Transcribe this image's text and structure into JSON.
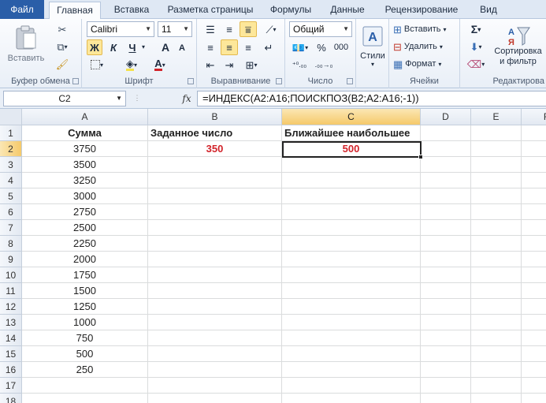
{
  "tabs": [
    "Файл",
    "Главная",
    "Вставка",
    "Разметка страницы",
    "Формулы",
    "Данные",
    "Рецензирование",
    "Вид"
  ],
  "ribbon": {
    "clipboard": {
      "paste_label": "Вставить",
      "group_label": "Буфер обмена"
    },
    "font": {
      "font_name": "Calibri",
      "font_size": "11",
      "bold": "Ж",
      "italic": "К",
      "underline": "Ч",
      "grow": "A",
      "shrink": "A",
      "font_color_glyph": "A",
      "group_label": "Шрифт"
    },
    "alignment": {
      "group_label": "Выравнивание"
    },
    "number": {
      "format": "Общий",
      "percent": "%",
      "thousands": "000",
      "group_label": "Число"
    },
    "styles": {
      "label": "Стили"
    },
    "cells": {
      "insert": "Вставить",
      "delete": "Удалить",
      "format": "Формат",
      "group_label": "Ячейки"
    },
    "editing": {
      "sigma": "Σ",
      "sort_line1": "Сортировка",
      "sort_line2": "и фильтр",
      "group_label": "Редактирова"
    }
  },
  "formula_bar": {
    "name_box": "C2",
    "fx": "fx",
    "formula": "=ИНДЕКС(A2:A16;ПОИСКПОЗ(B2;A2:A16;-1))"
  },
  "grid": {
    "columns": [
      "A",
      "B",
      "C",
      "D",
      "E",
      "F"
    ],
    "rows": [
      "1",
      "2",
      "3",
      "4",
      "5",
      "6",
      "7",
      "8",
      "9",
      "10",
      "11",
      "12",
      "13",
      "14",
      "15",
      "16",
      "17",
      "18"
    ],
    "header_row": {
      "a": "Сумма",
      "b": "Заданное число",
      "c": "Ближайшее наибольшее"
    },
    "target_value": "350",
    "result_value": "500",
    "amounts": [
      "3750",
      "3500",
      "3250",
      "3000",
      "2750",
      "2500",
      "2250",
      "2000",
      "1750",
      "1500",
      "1250",
      "1000",
      "750",
      "500",
      "250"
    ]
  },
  "colors": {
    "file_tab": "#2a5ea8",
    "selected_header": "#f5c96a",
    "result_red": "#d2232a"
  }
}
